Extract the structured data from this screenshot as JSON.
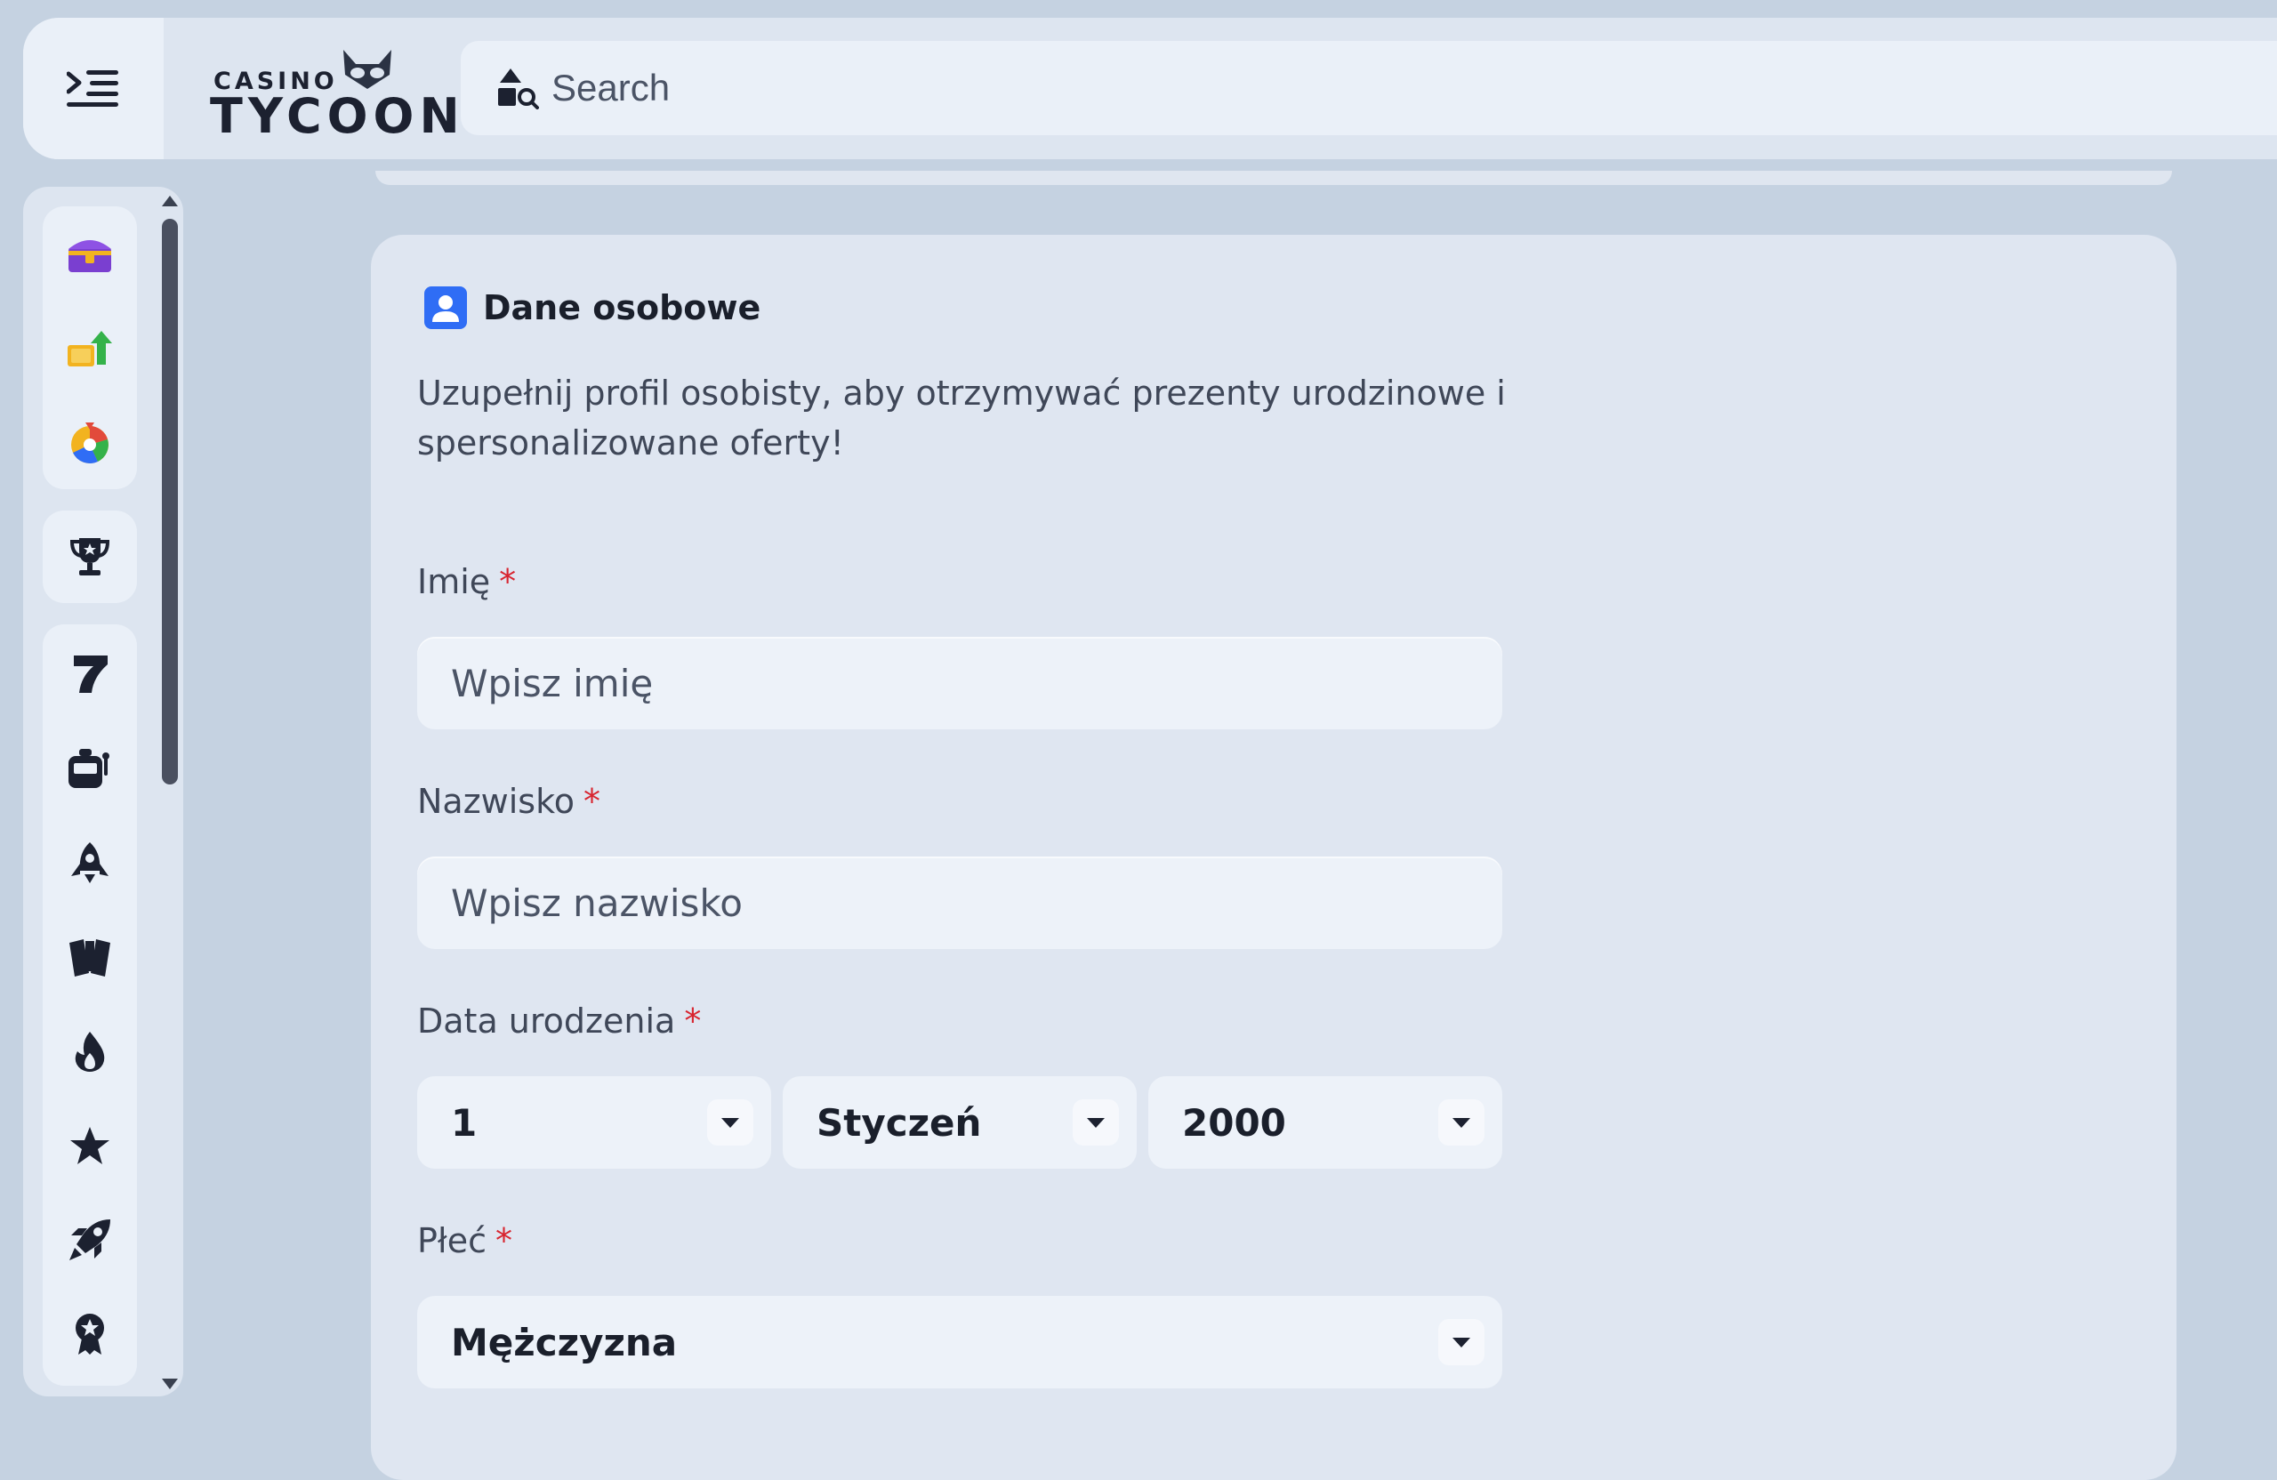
{
  "header": {
    "logo_top": "CASINO",
    "logo_bottom": "TYCOON",
    "search_placeholder": "Search",
    "icons": [
      "menu-icon",
      "shapes-search-icon"
    ]
  },
  "sidebar": {
    "groups": [
      {
        "items": [
          "treasure-chest-icon",
          "cashback-icon",
          "wheel-icon"
        ]
      },
      {
        "items": [
          "trophy-icon"
        ]
      },
      {
        "items": [
          "seven-icon",
          "slot-machine-icon",
          "rocket-crash-icon",
          "cards-icon",
          "fire-icon",
          "star-icon",
          "rocket-icon",
          "medal-icon"
        ]
      }
    ]
  },
  "form": {
    "title": "Dane osobowe",
    "subtitle": "Uzupełnij profil osobisty, aby otrzymywać prezenty urodzinowe i spersonalizowane oferty!",
    "first_name_label": "Imię",
    "first_name_placeholder": "Wpisz imię",
    "last_name_label": "Nazwisko",
    "last_name_placeholder": "Wpisz nazwisko",
    "birth_date_label": "Data urodzenia",
    "birth_day": "1",
    "birth_month": "Styczeń",
    "birth_year": "2000",
    "gender_label": "Płeć",
    "gender_value": "Mężczyzna",
    "required_mark": "*"
  },
  "colors": {
    "background": "#c5d2e1",
    "panel": "#dde5f0",
    "input": "#edf2f9",
    "required": "#d8242f",
    "accent_blue": "#2f6df5"
  }
}
